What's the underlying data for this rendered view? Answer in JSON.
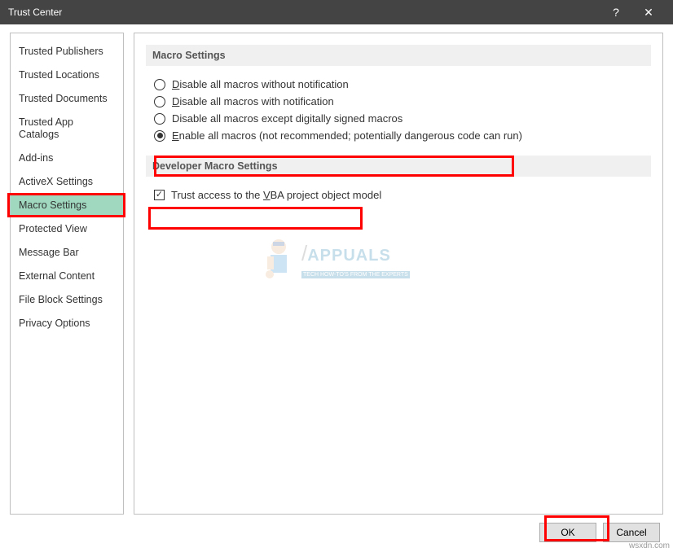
{
  "window": {
    "title": "Trust Center"
  },
  "sidebar": {
    "items": [
      {
        "label": "Trusted Publishers"
      },
      {
        "label": "Trusted Locations"
      },
      {
        "label": "Trusted Documents"
      },
      {
        "label": "Trusted App Catalogs"
      },
      {
        "label": "Add-ins"
      },
      {
        "label": "ActiveX Settings"
      },
      {
        "label": "Macro Settings"
      },
      {
        "label": "Protected View"
      },
      {
        "label": "Message Bar"
      },
      {
        "label": "External Content"
      },
      {
        "label": "File Block Settings"
      },
      {
        "label": "Privacy Options"
      }
    ],
    "selected_index": 6
  },
  "sections": {
    "macro": {
      "heading": "Macro Settings",
      "options": [
        {
          "label": "Disable all macros without notification",
          "checked": false
        },
        {
          "label": "Disable all macros with notification",
          "checked": false
        },
        {
          "label": "Disable all macros except digitally signed macros",
          "checked": false
        },
        {
          "label": "Enable all macros (not recommended; potentially dangerous code can run)",
          "checked": true
        }
      ]
    },
    "developer": {
      "heading": "Developer Macro Settings",
      "checkbox_label_pre": "Trust access to the ",
      "checkbox_label_u": "V",
      "checkbox_label_post": "BA project object model",
      "checked": true
    }
  },
  "buttons": {
    "ok": "OK",
    "cancel": "Cancel"
  },
  "watermark": {
    "brand": "APPUALS",
    "tag": "TECH HOW-TO'S FROM THE EXPERTS"
  },
  "attribution": "wsxdn.com"
}
